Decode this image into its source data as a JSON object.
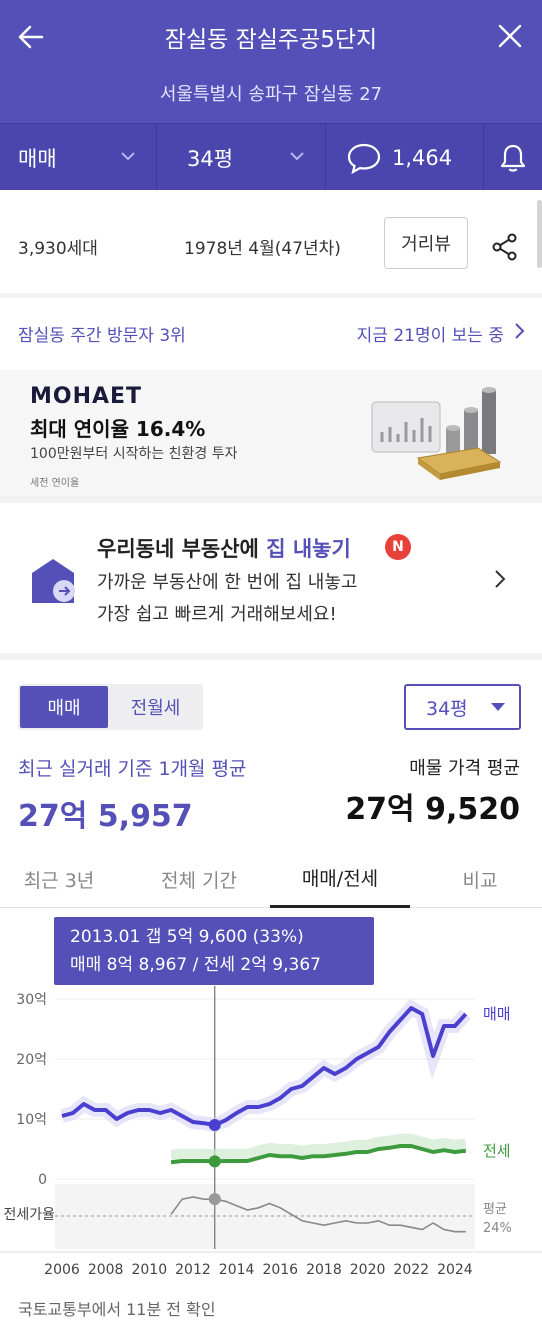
{
  "header": {
    "title": "잠실동 잠실주공5단지",
    "address": "서울특별시 송파구 잠실동 27",
    "filter_trade": "매매",
    "filter_size": "34평",
    "comment_count": "1,464"
  },
  "info": {
    "households": "3,930세대",
    "built": "1978년 4월(47년차)",
    "street_view_label": "거리뷰"
  },
  "visit": {
    "rank_text": "잠실동 주간 방문자 3위",
    "viewers_text": "지금 21명이 보는 중"
  },
  "ad": {
    "brand": "MOHAET",
    "headline": "최대 연이율 16.4%",
    "sub": "100만원부터 시작하는 친환경 투자",
    "note": "세전 연이율"
  },
  "promo": {
    "title_prefix": "우리동네 부동산에 ",
    "title_highlight": "집 내놓기",
    "badge": "N",
    "line1": "가까운 부동산에 한 번에 집 내놓고",
    "line2": "가장 쉽고 빠르게 거래해보세요!"
  },
  "price": {
    "seg_sale": "매매",
    "seg_rent": "전월세",
    "size_select": "34평",
    "recent_label": "최근 실거래 기준 1개월 평균",
    "recent_value": "27억 5,957",
    "ask_label": "매물 가격 평균",
    "ask_value": "27억 9,520"
  },
  "tabs": [
    "최근 3년",
    "전체 기간",
    "매매/전세",
    "비교"
  ],
  "tooltip": {
    "line1": "2013.01  갭 5억 9,600 (33%)",
    "line2": "매매 8억 8,967 / 전세 2억 9,367"
  },
  "chart_data": {
    "type": "line",
    "x": [
      2006,
      2006.5,
      2007,
      2007.5,
      2008,
      2008.5,
      2009,
      2009.5,
      2010,
      2010.5,
      2011,
      2011.5,
      2012,
      2012.5,
      2013,
      2013.5,
      2014,
      2014.5,
      2015,
      2015.5,
      2016,
      2016.5,
      2017,
      2017.5,
      2018,
      2018.5,
      2019,
      2019.5,
      2020,
      2020.5,
      2021,
      2021.5,
      2022,
      2022.5,
      2023,
      2023.5,
      2024,
      2024.5
    ],
    "series": [
      {
        "name": "매매",
        "color": "#4b3fd0",
        "values": [
          10.5,
          11,
          12.5,
          11.5,
          11.5,
          10,
          11,
          11.5,
          11.5,
          11,
          11.5,
          10.5,
          9.5,
          9.3,
          9.0,
          9.8,
          11,
          12,
          12,
          12.5,
          13.5,
          15,
          15.5,
          17,
          18.5,
          17.5,
          18.5,
          20,
          21,
          22,
          24.5,
          26.5,
          28.5,
          27.5,
          20.5,
          25.5,
          25.5,
          27.5
        ]
      },
      {
        "name": "전세",
        "color": "#3d9a3d",
        "values": [
          null,
          null,
          null,
          null,
          null,
          null,
          null,
          null,
          null,
          null,
          2.8,
          3.0,
          3.0,
          3.0,
          2.94,
          3.0,
          3.0,
          3.0,
          3.5,
          4.0,
          3.8,
          3.8,
          3.5,
          3.8,
          3.8,
          4.0,
          4.2,
          4.5,
          4.5,
          5.0,
          5.2,
          5.5,
          5.5,
          5.0,
          4.5,
          4.8,
          4.5,
          4.7
        ]
      },
      {
        "name": "전세가율",
        "color": "#888888",
        "values": [
          null,
          null,
          null,
          null,
          null,
          null,
          null,
          null,
          null,
          null,
          26,
          33,
          34,
          33,
          33,
          32,
          30,
          28,
          29,
          31,
          29,
          26,
          23,
          22,
          21,
          22,
          23,
          22,
          22,
          23,
          21,
          21,
          20,
          19,
          22,
          19,
          18,
          18
        ]
      }
    ],
    "yticks": [
      "30억",
      "20억",
      "10억",
      "0"
    ],
    "ylim": [
      0,
      30
    ],
    "xticks": [
      "2006",
      "2008",
      "2010",
      "2012",
      "2014",
      "2016",
      "2018",
      "2020",
      "2022",
      "2024"
    ],
    "ratio_label": "전세가율",
    "avg_label": "평균",
    "avg_value": "24%",
    "legend_sale": "매매",
    "legend_rent": "전세"
  },
  "footer": "국토교통부에서 11분 전 확인"
}
